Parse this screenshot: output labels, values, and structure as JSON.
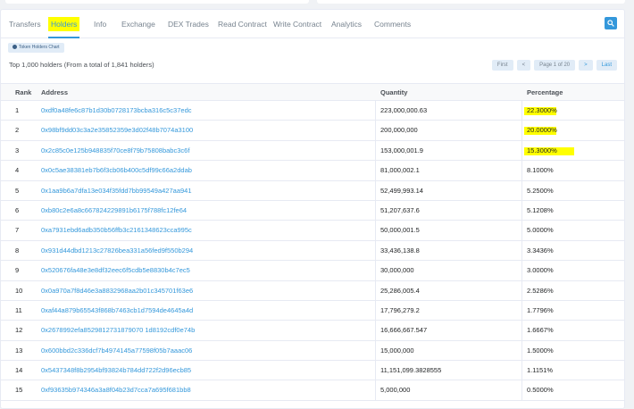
{
  "tabs": [
    "Transfers",
    "Holders",
    "Info",
    "Exchange",
    "DEX Trades",
    "Read Contract",
    "Write Contract",
    "Analytics",
    "Comments"
  ],
  "active_tab": "Holders",
  "chart_button": "Token Holders Chart",
  "summary": "Top 1,000 holders (From a total of 1,841 holders)",
  "pager": {
    "first": "First",
    "prev": "<",
    "page": "Page 1 of 20",
    "next": ">",
    "last": "Last"
  },
  "columns": {
    "rank": "Rank",
    "address": "Address",
    "quantity": "Quantity",
    "percentage": "Percentage"
  },
  "rows": [
    {
      "rank": "1",
      "address": "0xdf0a48fe6c87b1d30b0728173bcba316c5c37edc",
      "quantity": "223,000,000.63",
      "percentage": "22.3000%"
    },
    {
      "rank": "2",
      "address": "0x98bf9dd03c3a2e35852359e3d02f48b7074a3100",
      "quantity": "200,000,000",
      "percentage": "20.0000%"
    },
    {
      "rank": "3",
      "address": "0x2c85c0e125b948835f70ce8f79b75808babc3c6f",
      "quantity": "153,000,001.9",
      "percentage": "15.3000%"
    },
    {
      "rank": "4",
      "address": "0x0c5ae38381eb7b6f3cb06b400c5df99c66a2ddab",
      "quantity": "81,000,002.1",
      "percentage": "8.1000%"
    },
    {
      "rank": "5",
      "address": "0x1aa9b6a7dfa13e034f35fdd7bb99549a427aa941",
      "quantity": "52,499,993.14",
      "percentage": "5.2500%"
    },
    {
      "rank": "6",
      "address": "0xb80c2e6a8c667824229891b6175f788fc12fe64",
      "quantity": "51,207,637.6",
      "percentage": "5.1208%"
    },
    {
      "rank": "7",
      "address": "0xa7931ebd6adb350b56ffb3c2161348623cca995c",
      "quantity": "50,000,001.5",
      "percentage": "5.0000%"
    },
    {
      "rank": "8",
      "address": "0x931d44dbd1213c27826bea331a56fed9f550b294",
      "quantity": "33,436,138.8",
      "percentage": "3.3436%"
    },
    {
      "rank": "9",
      "address": "0x520676fa48e3e8df32eec6f5cdb5e8830b4c7ec5",
      "quantity": "30,000,000",
      "percentage": "3.0000%"
    },
    {
      "rank": "10",
      "address": "0x0a970a7f8d46e3a8832968aa2b01c345701f63e6",
      "quantity": "25,286,005.4",
      "percentage": "2.5286%"
    },
    {
      "rank": "11",
      "address": "0xaf44a879b65543f868b7463cb1d7594de4645a4d",
      "quantity": "17,796,279.2",
      "percentage": "1.7796%"
    },
    {
      "rank": "12",
      "address": "0x2678992efa8529812731879070 1d8192cdf0e74b",
      "quantity": "16,666,667.547",
      "percentage": "1.6667%"
    },
    {
      "rank": "13",
      "address": "0x600bbd2c336dcf7b4974145a77598f05b7aaac06",
      "quantity": "15,000,000",
      "percentage": "1.5000%"
    },
    {
      "rank": "14",
      "address": "0x5437348f8b2954bf93824b784dd722f2d96ecb85",
      "quantity": "11,151,099.3828555",
      "percentage": "1.1151%"
    },
    {
      "rank": "15",
      "address": "0xf93635b974346a3a8f04b23d7cca7a695f681bb8",
      "quantity": "5,000,000",
      "percentage": "0.5000%"
    }
  ],
  "colors": {
    "accent": "#3498db",
    "highlight": "#ffff00"
  },
  "icons": {
    "search": "search-icon",
    "chart": "pie-chart-icon"
  }
}
